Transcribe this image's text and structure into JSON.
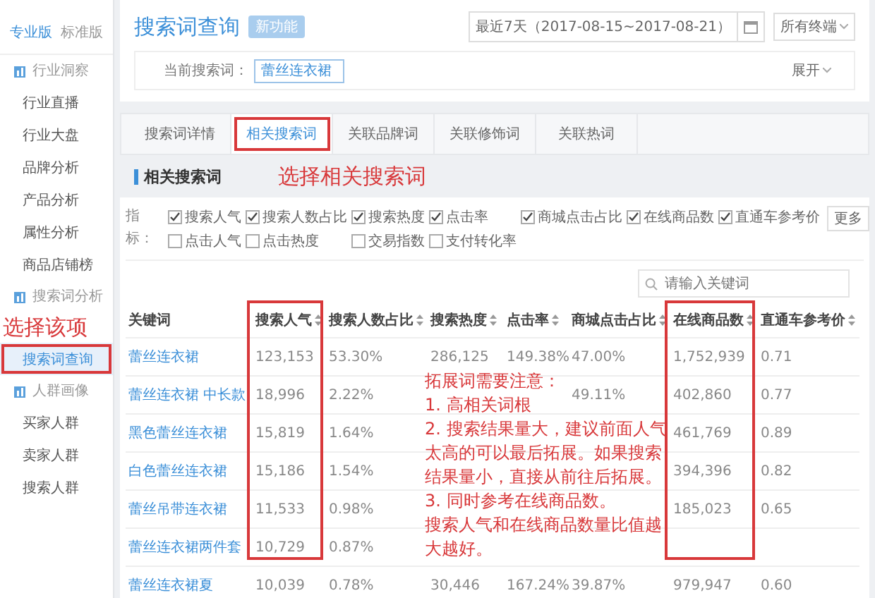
{
  "sidebar": {
    "editions": [
      {
        "label": "专业版",
        "selected": true
      },
      {
        "label": "标准版",
        "selected": false
      }
    ],
    "sections": [
      {
        "title": "行业洞察",
        "items": [
          {
            "label": "行业直播",
            "selected": false,
            "highlighted": false
          },
          {
            "label": "行业大盘",
            "selected": false,
            "highlighted": false
          },
          {
            "label": "品牌分析",
            "selected": false,
            "highlighted": false
          },
          {
            "label": "产品分析",
            "selected": false,
            "highlighted": false
          },
          {
            "label": "属性分析",
            "selected": false,
            "highlighted": false
          },
          {
            "label": "商品店铺榜",
            "selected": false,
            "highlighted": false
          }
        ]
      },
      {
        "title": "搜索词分析",
        "annotation": "选择该项",
        "items": [
          {
            "label": "搜索词查询",
            "selected": true,
            "highlighted": true
          }
        ]
      },
      {
        "title": "人群画像",
        "items": [
          {
            "label": "买家人群",
            "selected": false,
            "highlighted": false
          },
          {
            "label": "卖家人群",
            "selected": false,
            "highlighted": false
          },
          {
            "label": "搜索人群",
            "selected": false,
            "highlighted": false
          }
        ]
      }
    ]
  },
  "header": {
    "title": "搜索词查询",
    "badge": "新功能",
    "date_range": "最近7天（2017-08-15~2017-08-21）",
    "device": "所有终端",
    "query_label": "当前搜索词：",
    "query": "蕾丝连衣裙",
    "expand": "展开"
  },
  "tabs": [
    {
      "label": "搜索词详情",
      "selected": false,
      "highlighted": false
    },
    {
      "label": "相关搜索词",
      "selected": true,
      "highlighted": true
    },
    {
      "label": "关联品牌词",
      "selected": false,
      "highlighted": false
    },
    {
      "label": "关联修饰词",
      "selected": false,
      "highlighted": false
    },
    {
      "label": "关联热词",
      "selected": false,
      "highlighted": false
    }
  ],
  "section": {
    "title": "相关搜索词",
    "annotation": "选择相关搜索词"
  },
  "indicators": {
    "label": "指标：",
    "more": "更多",
    "items": [
      {
        "label": "搜索人气",
        "checked": true
      },
      {
        "label": "搜索人数占比",
        "checked": true
      },
      {
        "label": "搜索热度",
        "checked": true
      },
      {
        "label": "点击率",
        "checked": true
      },
      {
        "label": "商城点击占比",
        "checked": true
      },
      {
        "label": "在线商品数",
        "checked": true
      },
      {
        "label": "直通车参考价",
        "checked": true
      },
      {
        "label": "点击人气",
        "checked": false
      },
      {
        "label": "点击热度",
        "checked": false
      },
      {
        "label": "交易指数",
        "checked": false
      },
      {
        "label": "支付转化率",
        "checked": false
      }
    ]
  },
  "search": {
    "placeholder": "请输入关键词"
  },
  "table": {
    "columns": [
      {
        "label": "关键词",
        "sortable": false,
        "highlighted": false
      },
      {
        "label": "搜索人气",
        "sortable": true,
        "highlighted": true
      },
      {
        "label": "搜索人数占比",
        "sortable": true,
        "highlighted": false
      },
      {
        "label": "搜索热度",
        "sortable": true,
        "highlighted": false
      },
      {
        "label": "点击率",
        "sortable": true,
        "highlighted": false
      },
      {
        "label": "商城点击占比",
        "sortable": true,
        "highlighted": false
      },
      {
        "label": "在线商品数",
        "sortable": true,
        "highlighted": true
      },
      {
        "label": "直通车参考价",
        "sortable": true,
        "highlighted": false
      }
    ],
    "rows": [
      [
        "蕾丝连衣裙",
        "123,153",
        "53.30%",
        "286,125",
        "149.38%",
        "47.00%",
        "1,752,939",
        "0.71"
      ],
      [
        "蕾丝连衣裙 中长款",
        "18,996",
        "2.22%",
        null,
        null,
        "49.11%",
        "402,860",
        "0.77"
      ],
      [
        "黑色蕾丝连衣裙",
        "15,819",
        "1.64%",
        null,
        null,
        null,
        "461,769",
        "0.89"
      ],
      [
        "白色蕾丝连衣裙",
        "15,186",
        "1.54%",
        null,
        null,
        null,
        "394,396",
        "0.82"
      ],
      [
        "蕾丝吊带连衣裙",
        "11,533",
        "0.98%",
        null,
        null,
        null,
        "185,023",
        "0.65"
      ],
      [
        "蕾丝连衣裙两件套",
        "10,729",
        "0.87%",
        null,
        null,
        null,
        null,
        null
      ],
      [
        "蕾丝连衣裙夏",
        "10,039",
        "0.78%",
        "30,446",
        "167.24%",
        "39.87%",
        "979,947",
        "0.60"
      ]
    ]
  },
  "note": {
    "lines": [
      "拓展词需要注意：",
      "1. 高相关词根",
      "2. 搜索结果量大，建议前面人气",
      "太高的可以最后拓展。如果搜索",
      "结果量小，直接从前往后拓展。",
      "3. 同时参考在线商品数。",
      "搜索人气和在线商品数量比值越",
      "大越好。"
    ]
  }
}
